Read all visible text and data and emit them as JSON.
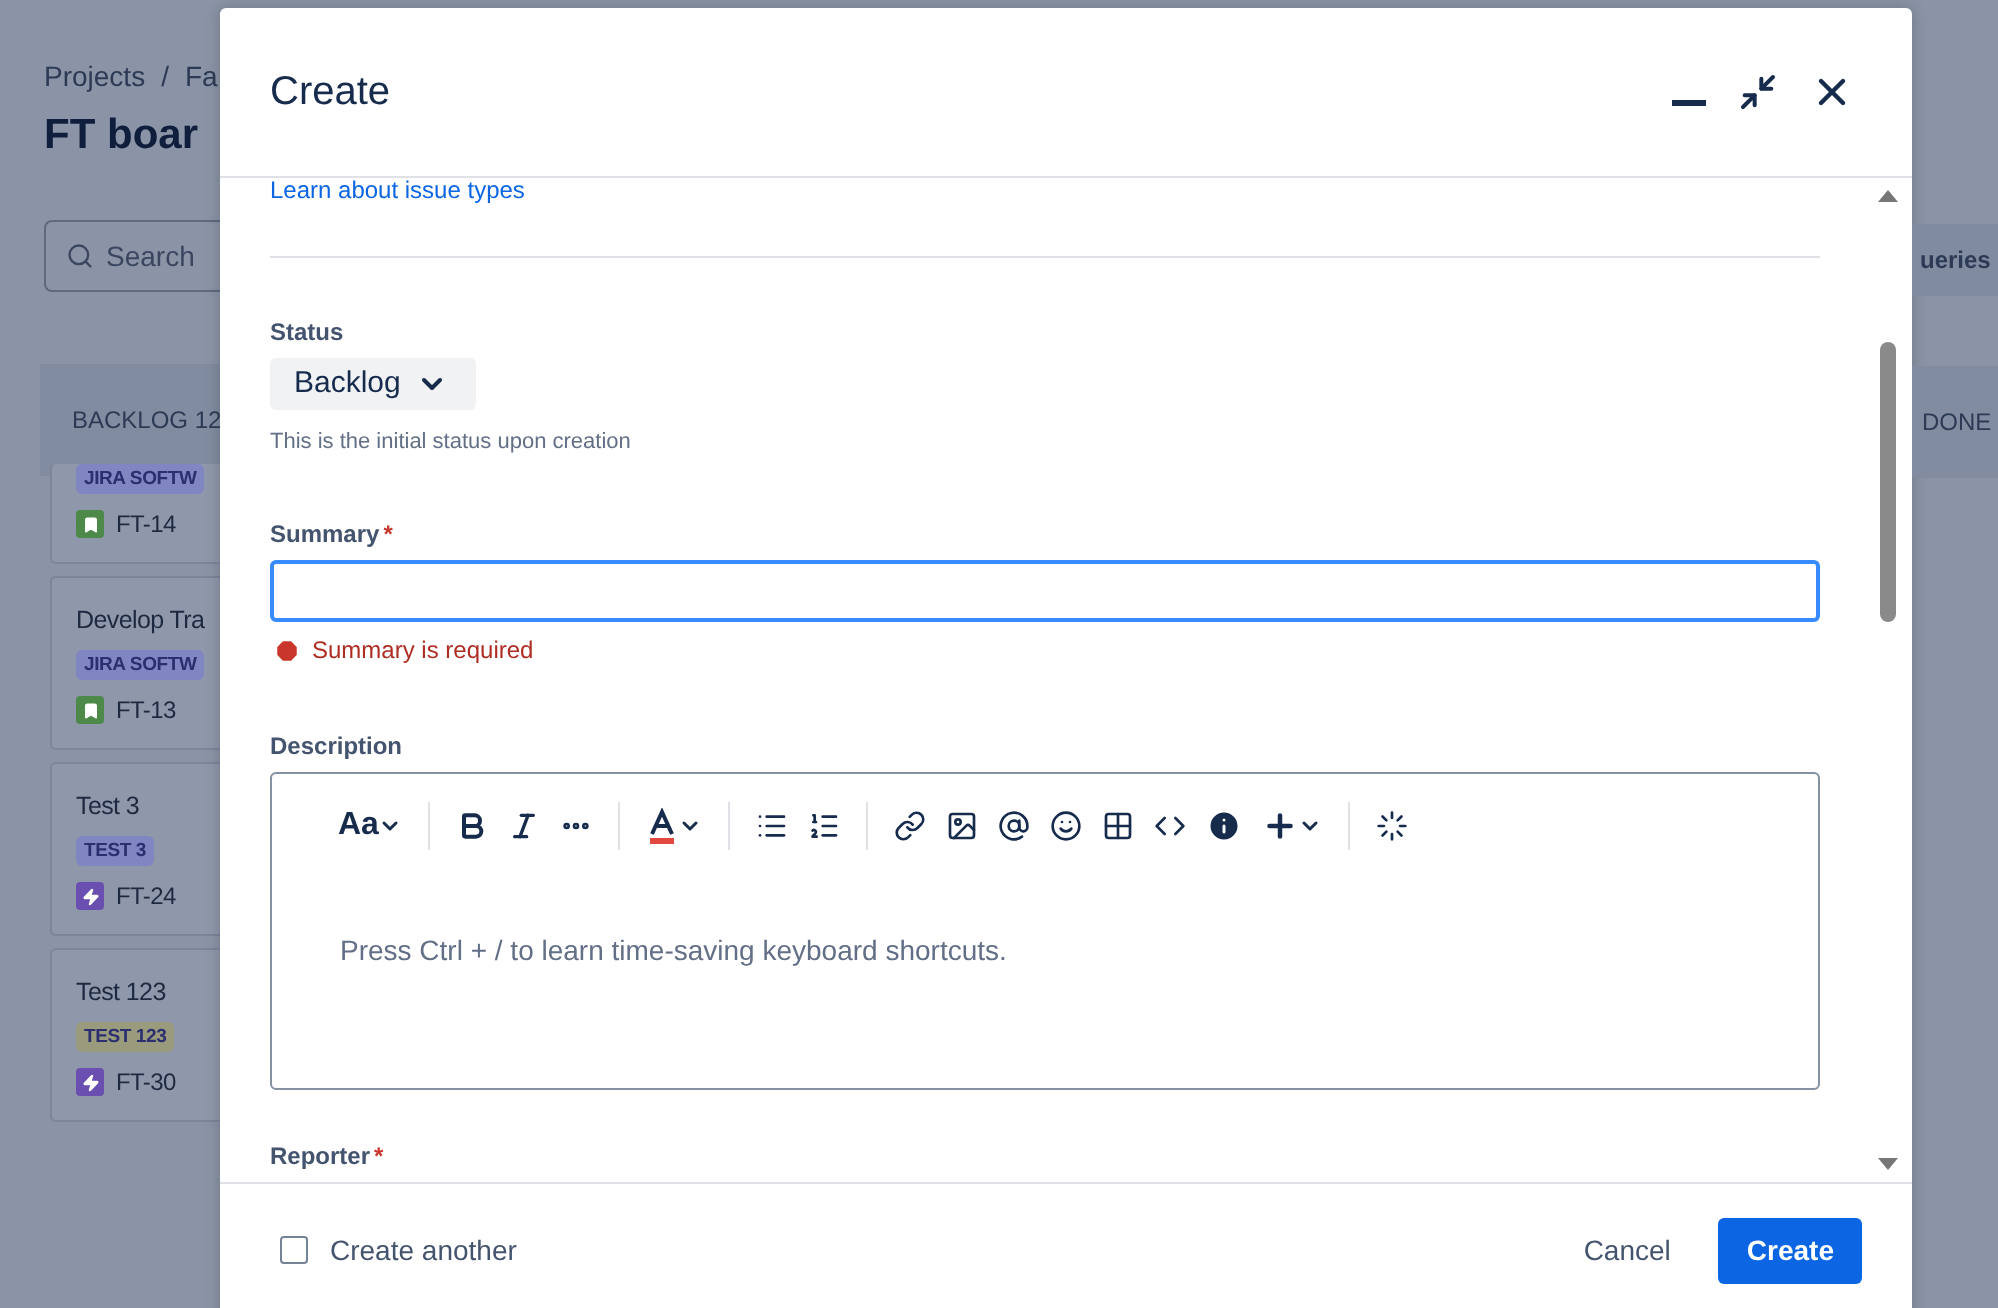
{
  "board": {
    "breadcrumbs": [
      "Projects",
      "Fa"
    ],
    "breadcrumb_separator": "/",
    "title": "FT boar",
    "search": {
      "placeholder": "Search"
    },
    "column": "BACKLOG 12",
    "cards": [
      {
        "tag": "JIRA SOFTW",
        "color": "#7f86c2",
        "kind": "story",
        "key": "FT-14"
      },
      {
        "summary": "Develop Tra",
        "tag": "JIRA SOFTW",
        "color": "#7f86c2",
        "kind": "story",
        "key": "FT-13"
      },
      {
        "summary": "Test 3",
        "tag": "TEST 3",
        "color": "#7f86c2",
        "kind": "epic",
        "key": "FT-24"
      },
      {
        "summary": "Test 123",
        "tag": "TEST 123",
        "color": "#9a9a7c",
        "kind": "epic",
        "key": "FT-30"
      }
    ],
    "right_button": "ueries",
    "right_column": "DONE"
  },
  "modal": {
    "title": "Create",
    "learn_link": "Learn about issue types",
    "status": {
      "label": "Status",
      "value": "Backlog",
      "helper": "This is the initial status upon creation"
    },
    "summary": {
      "label": "Summary",
      "required_mark": "*",
      "error": "Summary is required"
    },
    "description": {
      "label": "Description",
      "toolbar_text": "Aa",
      "placeholder": "Press Ctrl + / to learn time-saving keyboard shortcuts."
    },
    "reporter": {
      "label": "Reporter",
      "required_mark": "*"
    },
    "create_another": {
      "label": "Create another",
      "checked": false
    },
    "buttons": [
      {
        "label": "Cancel",
        "kind": "subtle"
      },
      {
        "label": "Create",
        "kind": "primary"
      }
    ]
  }
}
